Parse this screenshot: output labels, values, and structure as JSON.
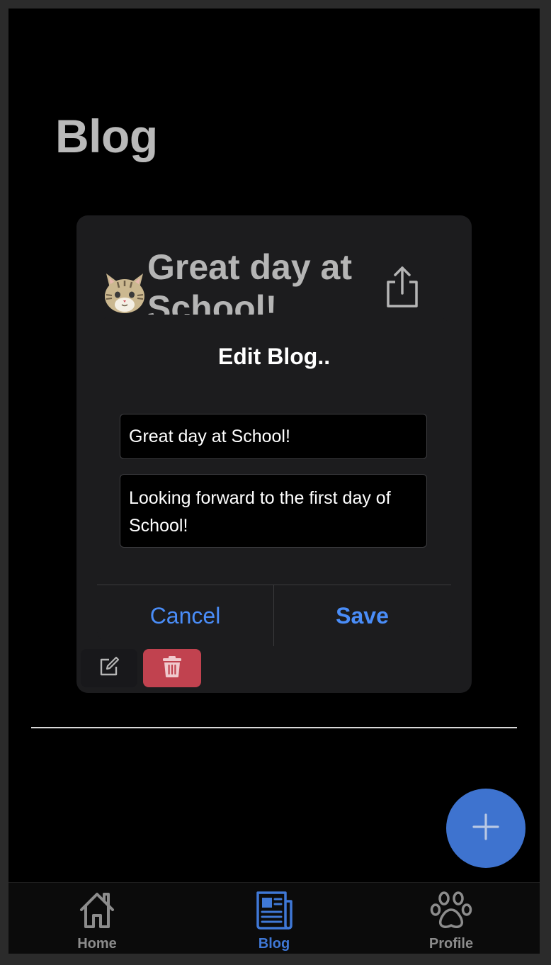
{
  "header": {
    "title": "Blog"
  },
  "card": {
    "title": "Great day at School!",
    "avatar_icon": "cat-face-icon",
    "share_icon": "share-icon",
    "edit_icon": "edit-icon",
    "delete_icon": "trash-icon"
  },
  "dialog": {
    "title": "Edit Blog..",
    "title_value": "Great day at School!",
    "body_value": "Looking forward to the first day of School!",
    "cancel_label": "Cancel",
    "save_label": "Save"
  },
  "fab": {
    "icon": "plus-icon"
  },
  "tabs": [
    {
      "label": "Home",
      "icon": "home-icon",
      "active": false
    },
    {
      "label": "Blog",
      "icon": "newspaper-icon",
      "active": true
    },
    {
      "label": "Profile",
      "icon": "paw-icon",
      "active": false
    }
  ],
  "colors": {
    "accent": "#4a8df8",
    "tab_active": "#3f78d6",
    "fab": "#3e73cf",
    "delete": "#c1424f",
    "card_bg": "#1c1c1e"
  }
}
